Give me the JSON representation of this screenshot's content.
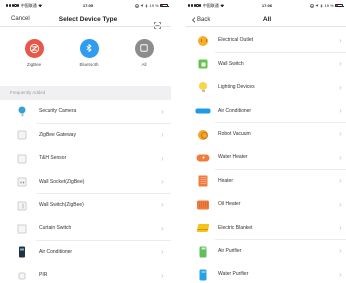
{
  "left_screen": {
    "status_bar": {
      "signal_level": 3,
      "signal_max": 5,
      "carrier": "中国联通",
      "time": "17:05",
      "battery_text": "19 %",
      "battery_level": 0.19,
      "icons": [
        "wifi-icon",
        "orientation-lock-icon",
        "location-icon",
        "bluetooth-icon",
        "battery-icon"
      ]
    },
    "nav": {
      "cancel_label": "Cancel",
      "title": "Select Device Type",
      "scan_icon": "scan-icon"
    },
    "categories": [
      {
        "label": "ZigBee",
        "icon": "zigbee-icon",
        "color": "#e6594a"
      },
      {
        "label": "Bluetooth",
        "icon": "bluetooth-icon",
        "color": "#2f9cf0"
      },
      {
        "label": "All",
        "icon": "all-devices-icon",
        "color": "#8c8c8c"
      }
    ],
    "section_header": "Frequently Added",
    "devices": [
      {
        "label": "Security Camera",
        "icon": "security-camera-icon",
        "color": "#37a0d8"
      },
      {
        "label": "ZigBee Gateway",
        "icon": "zigbee-gateway-icon",
        "color": "#f4f4f4"
      },
      {
        "label": "T&H Sensor",
        "icon": "th-sensor-icon",
        "color": "#f6f6f6"
      },
      {
        "label": "Wall Socket(ZigBee)",
        "icon": "wall-socket-icon",
        "color": "#f4f4f4"
      },
      {
        "label": "Wall Switch(ZigBee)",
        "icon": "wall-switch-icon",
        "color": "#f4f4f4"
      },
      {
        "label": "Curtain Switch",
        "icon": "curtain-switch-icon",
        "color": "#f6f6f6"
      },
      {
        "label": "Air Conditioner",
        "icon": "air-conditioner-icon",
        "color": "#24313f"
      },
      {
        "label": "PIR",
        "icon": "pir-sensor-icon",
        "color": "#f6f6f6"
      }
    ]
  },
  "right_screen": {
    "status_bar": {
      "signal_level": 3,
      "signal_max": 5,
      "carrier": "中国联通",
      "time": "17:06",
      "battery_text": "19 %",
      "battery_level": 0.19,
      "icons": [
        "wifi-icon",
        "orientation-lock-icon",
        "location-icon",
        "bluetooth-icon",
        "battery-icon"
      ]
    },
    "nav": {
      "back_label": "Back",
      "title": "All",
      "back_icon": "chevron-left-icon"
    },
    "devices": [
      {
        "label": "Electrical Outlet",
        "icon": "electrical-outlet-icon",
        "color": "#f7ae2b"
      },
      {
        "label": "Wall Switch",
        "icon": "wall-switch-icon",
        "color": "#66c34a"
      },
      {
        "label": "Lighting Devices",
        "icon": "lighting-devices-icon",
        "color": "#f9d548"
      },
      {
        "label": "Air Conditioner",
        "icon": "air-conditioner-icon",
        "color": "#1f9ae6"
      },
      {
        "label": "Robot Vacuum",
        "icon": "robot-vacuum-icon",
        "color": "#f6a52a"
      },
      {
        "label": "Water Heater",
        "icon": "water-heater-icon",
        "color": "#f27a3c"
      },
      {
        "label": "Heater",
        "icon": "heater-icon",
        "color": "#f27a3c"
      },
      {
        "label": "Oil Heater",
        "icon": "oil-heater-icon",
        "color": "#f27a3c"
      },
      {
        "label": "Electric Blanket",
        "icon": "electric-blanket-icon",
        "color": "#f5c31a"
      },
      {
        "label": "Air Purifier",
        "icon": "air-purifier-icon",
        "color": "#5fc05a"
      },
      {
        "label": "Water Purifier",
        "icon": "water-purifier-icon",
        "color": "#28a2e6"
      }
    ]
  }
}
